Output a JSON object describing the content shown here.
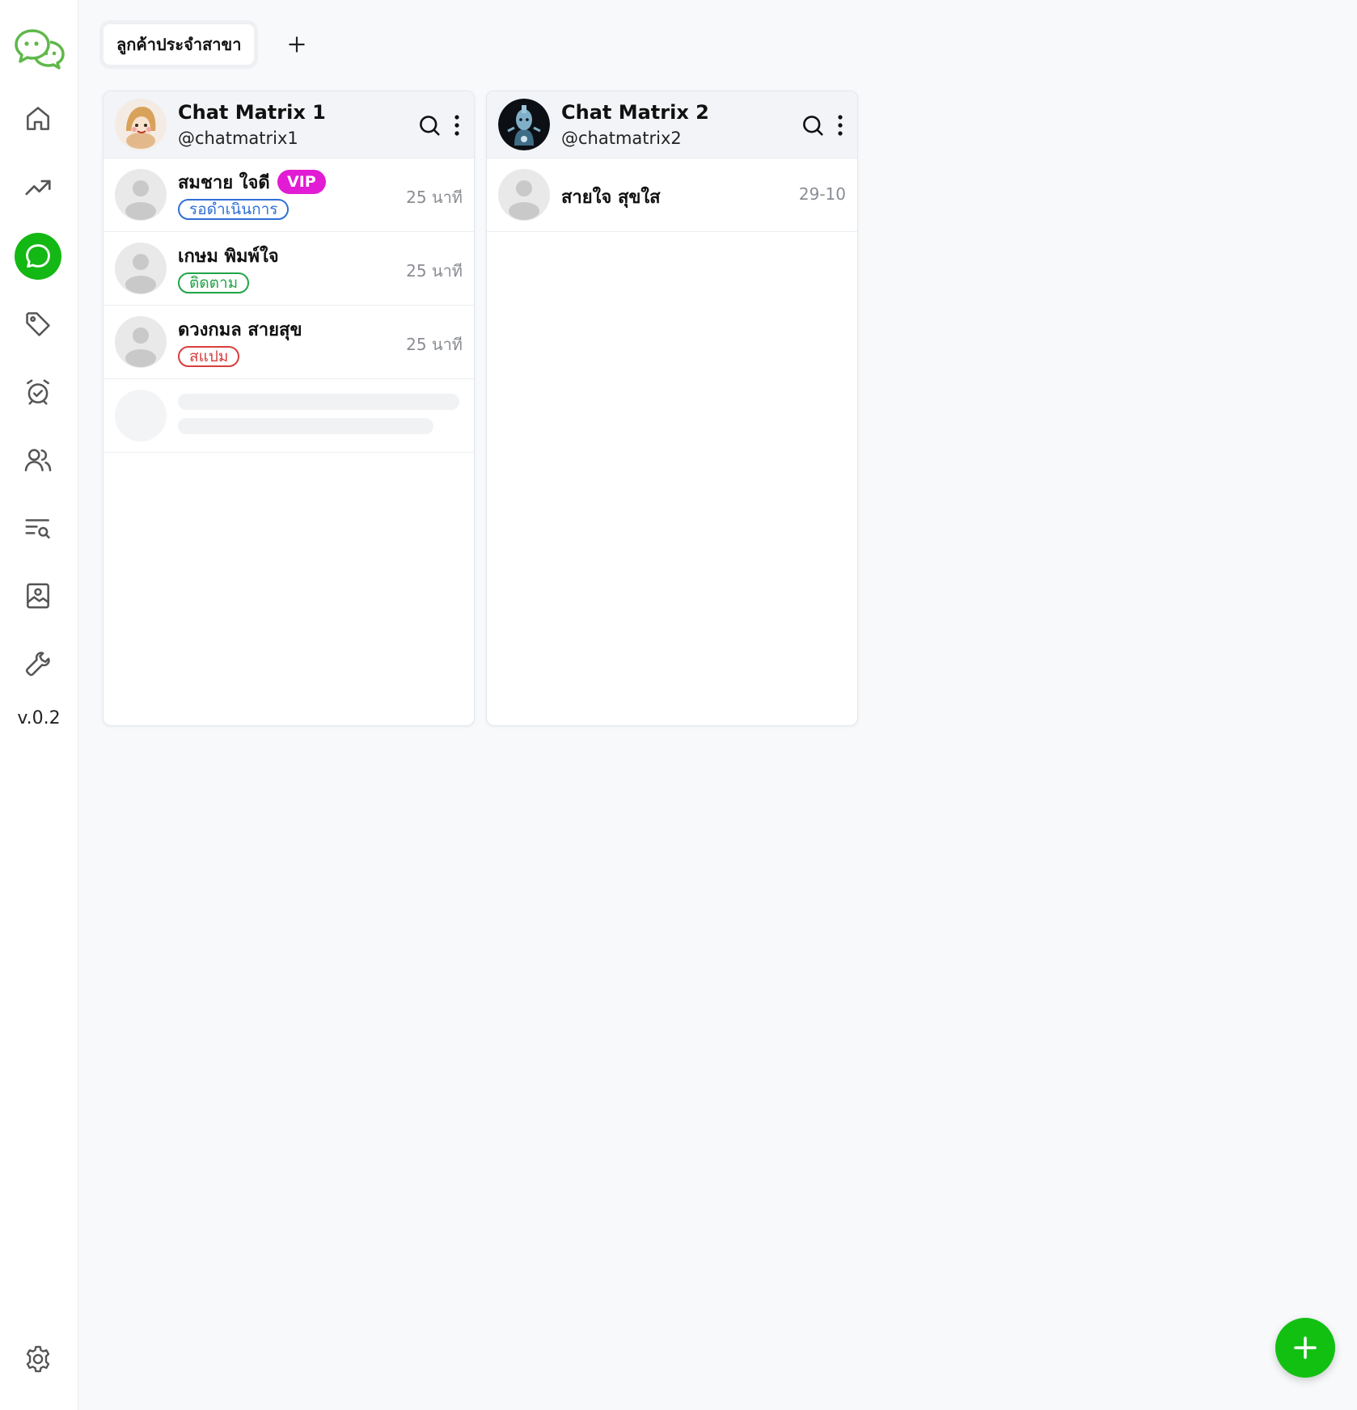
{
  "sidebar": {
    "nav": [
      {
        "icon": "home-icon"
      },
      {
        "icon": "trending-up-icon"
      },
      {
        "icon": "chat-icon",
        "active": true
      },
      {
        "icon": "tag-icon"
      },
      {
        "icon": "alarm-clock-icon"
      },
      {
        "icon": "users-icon"
      },
      {
        "icon": "list-search-icon"
      },
      {
        "icon": "gallery-icon"
      },
      {
        "icon": "wrench-icon"
      }
    ],
    "version": "v.0.2",
    "settings_icon": "gear-icon"
  },
  "tabs": [
    {
      "label": "ลูกค้าประจำสาขา",
      "active": true
    }
  ],
  "columns": [
    {
      "title": "Chat Matrix 1",
      "handle": "@chatmatrix1",
      "chats": [
        {
          "name": "สมชาย ใจดี",
          "badge": "VIP",
          "status": "รอดำเนินการ",
          "time": "25 นาที"
        },
        {
          "name": "เกษม พิมพ์ใจ",
          "status": "ติดตาม",
          "time": "25 นาที"
        },
        {
          "name": "ดวงกมล สายสุข",
          "status": "สแปม",
          "time": "25 นาที"
        }
      ]
    },
    {
      "title": "Chat Matrix 2",
      "handle": "@chatmatrix2",
      "chats": [
        {
          "name": "สายใจ สุขใส",
          "time": "29-10"
        }
      ]
    }
  ],
  "colors": {
    "accent_green": "#14b814",
    "vip_magenta": "#e21bd4",
    "status_pending": "#2f6fd6",
    "status_follow": "#22a447",
    "status_spam": "#d93d3d"
  }
}
